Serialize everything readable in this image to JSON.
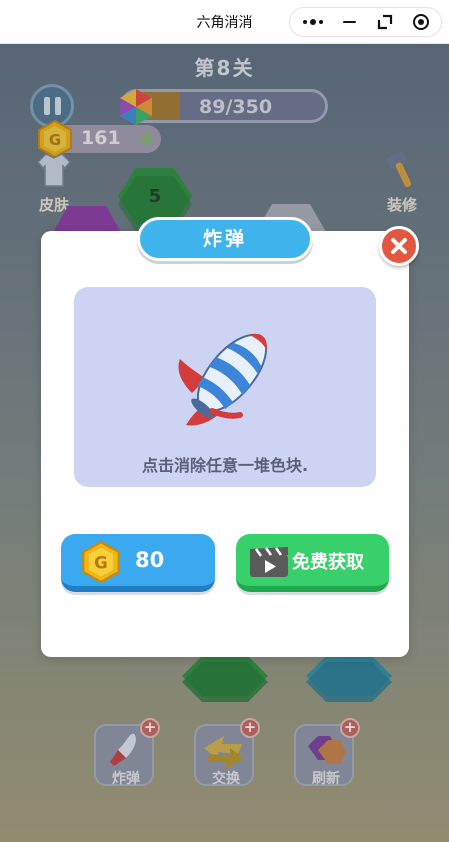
{
  "window": {
    "title": "六角消消"
  },
  "capsule": {
    "menu_icon": "more-dots-icon",
    "minimize_icon": "minimize-icon",
    "restore_icon": "restore-icon",
    "exit_icon": "target-icon"
  },
  "game": {
    "level_label": "第8关",
    "progress": {
      "text": "89/350",
      "current": 89,
      "total": 350
    },
    "coins": {
      "value": "161"
    },
    "skin_label": "皮肤",
    "decor_label": "装修",
    "board_top_hex_label": "5",
    "tools": [
      {
        "label": "炸弹",
        "icon": "rocket-icon"
      },
      {
        "label": "交换",
        "icon": "swap-arrows-icon"
      },
      {
        "label": "刷新",
        "icon": "hexagon-refresh-icon"
      }
    ]
  },
  "modal": {
    "title": "炸弹",
    "description": "点击消除任意一堆色块.",
    "buy_price": "80",
    "free_label": "免费获取",
    "colors": {
      "title_bg": "#3fb3ec",
      "close_bg": "#e1573f",
      "card_bg": "#ccd3f3",
      "buy_bg": "#3aa9ef",
      "free_bg": "#38d06a"
    }
  }
}
